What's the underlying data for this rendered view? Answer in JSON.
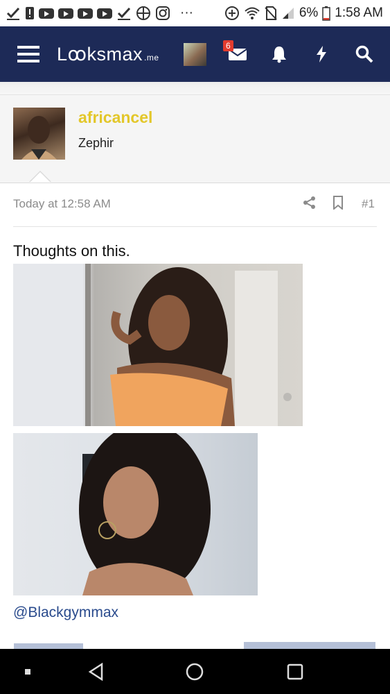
{
  "status_bar": {
    "battery": "6%",
    "time": "1:58 AM",
    "more_glyph": "···"
  },
  "navbar": {
    "logo_main": "Lꝏksmax",
    "logo_suffix": ".me",
    "notification_count": "6",
    "icons": [
      "menu-icon",
      "avatar-thumbnail",
      "envelope-icon",
      "bell-icon",
      "lightning-icon",
      "search-icon"
    ]
  },
  "post": {
    "author": {
      "username": "africancel",
      "user_title": "Zephir"
    },
    "timestamp": "Today at 12:58 AM",
    "post_number": "#1",
    "text": "Thoughts on this.",
    "mention": "@Blackgymmax",
    "images": [
      {
        "name": "post-image-1"
      },
      {
        "name": "post-image-2"
      }
    ]
  },
  "colors": {
    "navbar_bg": "#1d2a57",
    "username": "#e3c72a",
    "link": "#2a4b8d",
    "badge": "#e23b2e"
  }
}
